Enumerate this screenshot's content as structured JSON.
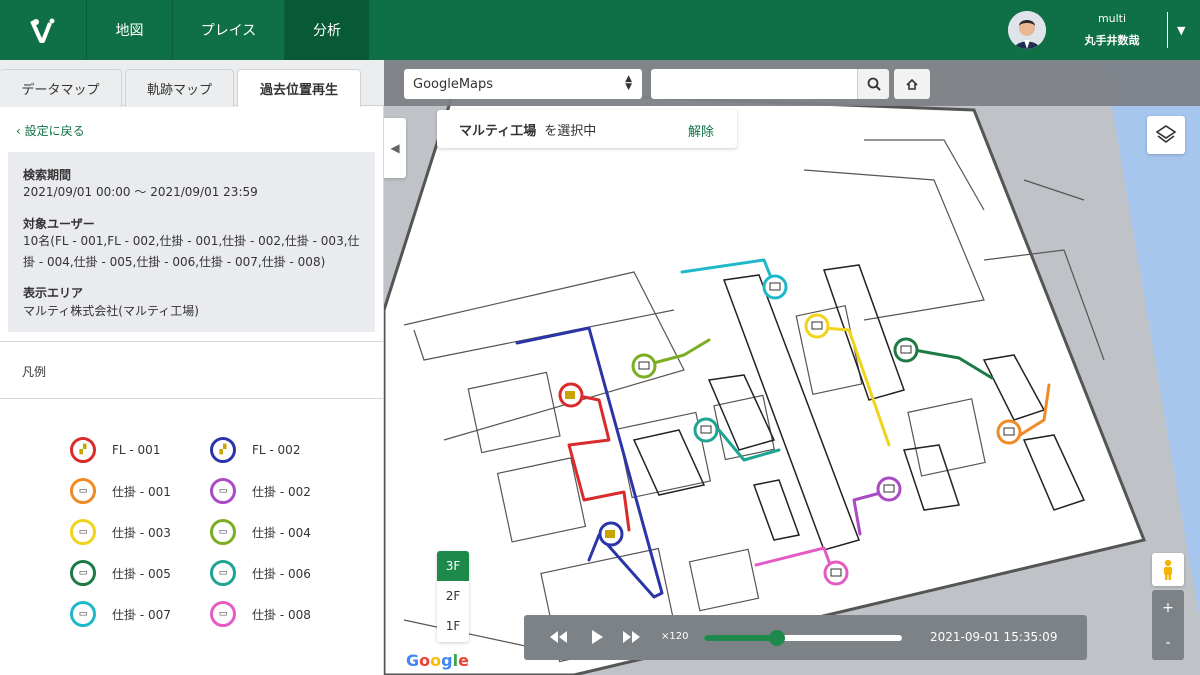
{
  "header": {
    "tabs": [
      {
        "label": "地図"
      },
      {
        "label": "プレイス"
      },
      {
        "label": "分析"
      }
    ],
    "user": {
      "name": "multi",
      "org": "丸手井数哉"
    },
    "brand_color": "#0f7047"
  },
  "panel": {
    "tabs": [
      {
        "label": "データマップ"
      },
      {
        "label": "軌跡マップ"
      },
      {
        "label": "過去位置再生"
      }
    ],
    "back_label": "設定に戻る",
    "period_label": "検索期間",
    "period_value": "2021/09/01 00:00 〜 2021/09/01 23:59",
    "users_label": "対象ユーザー",
    "users_value": "10名(FL - 001,FL - 002,仕掛 - 001,仕掛 - 002,仕掛 - 003,仕掛 - 004,仕掛 - 005,仕掛 - 006,仕掛 - 007,仕掛 - 008)",
    "area_label": "表示エリア",
    "area_value": "マルティ株式会社(マルティ工場)",
    "legend_title": "凡例",
    "legend": [
      {
        "label": "FL - 001",
        "color": "#d92b2b",
        "icon": "forklift-icon"
      },
      {
        "label": "FL - 002",
        "color": "#2b35a8",
        "icon": "forklift-icon"
      },
      {
        "label": "仕掛 - 001",
        "color": "#f08a24",
        "icon": "cart-icon"
      },
      {
        "label": "仕掛 - 002",
        "color": "#a84bc4",
        "icon": "cart-icon"
      },
      {
        "label": "仕掛 - 003",
        "color": "#f2d31b",
        "icon": "cart-icon"
      },
      {
        "label": "仕掛 - 004",
        "color": "#7cae22",
        "icon": "cart-icon"
      },
      {
        "label": "仕掛 - 005",
        "color": "#1d7a44",
        "icon": "cart-icon"
      },
      {
        "label": "仕掛 - 006",
        "color": "#1fa393",
        "icon": "cart-icon"
      },
      {
        "label": "仕掛 - 007",
        "color": "#1fb8c9",
        "icon": "cart-icon"
      },
      {
        "label": "仕掛 - 008",
        "color": "#e45bc4",
        "icon": "cart-icon"
      }
    ]
  },
  "map": {
    "type_select": "GoogleMaps",
    "search_placeholder": "",
    "selection_name": "マルティ工場",
    "selection_state": "を選択中",
    "cancel_label": "解除",
    "floors": [
      "3F",
      "2F",
      "1F"
    ],
    "active_floor": "3F",
    "zoom_in": "+",
    "zoom_out": "-",
    "google_letters": [
      "G",
      "o",
      "o",
      "g",
      "l",
      "e"
    ],
    "player": {
      "speed": "×120",
      "progress": 0.37,
      "time": "2021-09-01 15:35:09"
    }
  }
}
